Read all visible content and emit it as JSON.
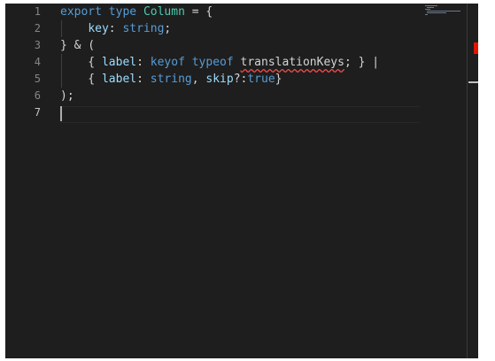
{
  "editor": {
    "line_numbers": [
      "1",
      "2",
      "3",
      "4",
      "5",
      "6",
      "7"
    ],
    "lines": [
      [
        {
          "t": "export",
          "c": "kw"
        },
        {
          "t": " ",
          "c": "pu"
        },
        {
          "t": "type",
          "c": "kw"
        },
        {
          "t": " ",
          "c": "pu"
        },
        {
          "t": "Column",
          "c": "ty"
        },
        {
          "t": " = {",
          "c": "pu"
        }
      ],
      [
        {
          "t": "    ",
          "c": "pu"
        },
        {
          "t": "key",
          "c": "id"
        },
        {
          "t": ": ",
          "c": "pu"
        },
        {
          "t": "string",
          "c": "kw"
        },
        {
          "t": ";",
          "c": "pu"
        }
      ],
      [
        {
          "t": "} & (",
          "c": "pu"
        }
      ],
      [
        {
          "t": "    { ",
          "c": "pu"
        },
        {
          "t": "label",
          "c": "id"
        },
        {
          "t": ": ",
          "c": "pu"
        },
        {
          "t": "keyof",
          "c": "kw"
        },
        {
          "t": " ",
          "c": "pu"
        },
        {
          "t": "typeof",
          "c": "kw"
        },
        {
          "t": " ",
          "c": "pu"
        },
        {
          "t": "translationKeys",
          "c": "pu err"
        },
        {
          "t": "; } |",
          "c": "pu"
        }
      ],
      [
        {
          "t": "    { ",
          "c": "pu"
        },
        {
          "t": "label",
          "c": "id"
        },
        {
          "t": ": ",
          "c": "pu"
        },
        {
          "t": "string",
          "c": "kw"
        },
        {
          "t": ", ",
          "c": "pu"
        },
        {
          "t": "skip",
          "c": "id"
        },
        {
          "t": "?:",
          "c": "pu"
        },
        {
          "t": "true",
          "c": "kw"
        },
        {
          "t": "}",
          "c": "pu"
        }
      ],
      [
        {
          "t": ");",
          "c": "pu"
        }
      ],
      []
    ],
    "active_line": 7,
    "error_word": "translationKeys"
  },
  "colors": {
    "background": "#1e1e1e",
    "keyword": "#569cd6",
    "type": "#4ec9b0",
    "identifier": "#9cdcfe",
    "error_squiggle": "#f14c4c",
    "scrollbar_error_marker": "#e51400"
  }
}
